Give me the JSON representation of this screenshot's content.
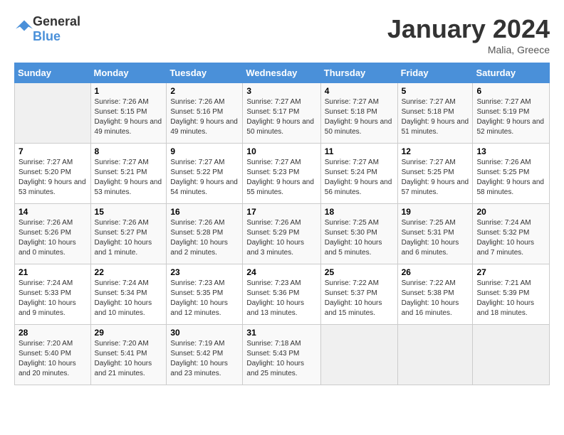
{
  "header": {
    "logo_general": "General",
    "logo_blue": "Blue",
    "title": "January 2024",
    "subtitle": "Malia, Greece"
  },
  "weekdays": [
    "Sunday",
    "Monday",
    "Tuesday",
    "Wednesday",
    "Thursday",
    "Friday",
    "Saturday"
  ],
  "weeks": [
    [
      {
        "day": "",
        "sunrise": "",
        "sunset": "",
        "daylight": ""
      },
      {
        "day": "1",
        "sunrise": "Sunrise: 7:26 AM",
        "sunset": "Sunset: 5:15 PM",
        "daylight": "Daylight: 9 hours and 49 minutes."
      },
      {
        "day": "2",
        "sunrise": "Sunrise: 7:26 AM",
        "sunset": "Sunset: 5:16 PM",
        "daylight": "Daylight: 9 hours and 49 minutes."
      },
      {
        "day": "3",
        "sunrise": "Sunrise: 7:27 AM",
        "sunset": "Sunset: 5:17 PM",
        "daylight": "Daylight: 9 hours and 50 minutes."
      },
      {
        "day": "4",
        "sunrise": "Sunrise: 7:27 AM",
        "sunset": "Sunset: 5:18 PM",
        "daylight": "Daylight: 9 hours and 50 minutes."
      },
      {
        "day": "5",
        "sunrise": "Sunrise: 7:27 AM",
        "sunset": "Sunset: 5:18 PM",
        "daylight": "Daylight: 9 hours and 51 minutes."
      },
      {
        "day": "6",
        "sunrise": "Sunrise: 7:27 AM",
        "sunset": "Sunset: 5:19 PM",
        "daylight": "Daylight: 9 hours and 52 minutes."
      }
    ],
    [
      {
        "day": "7",
        "sunrise": "Sunrise: 7:27 AM",
        "sunset": "Sunset: 5:20 PM",
        "daylight": "Daylight: 9 hours and 53 minutes."
      },
      {
        "day": "8",
        "sunrise": "Sunrise: 7:27 AM",
        "sunset": "Sunset: 5:21 PM",
        "daylight": "Daylight: 9 hours and 53 minutes."
      },
      {
        "day": "9",
        "sunrise": "Sunrise: 7:27 AM",
        "sunset": "Sunset: 5:22 PM",
        "daylight": "Daylight: 9 hours and 54 minutes."
      },
      {
        "day": "10",
        "sunrise": "Sunrise: 7:27 AM",
        "sunset": "Sunset: 5:23 PM",
        "daylight": "Daylight: 9 hours and 55 minutes."
      },
      {
        "day": "11",
        "sunrise": "Sunrise: 7:27 AM",
        "sunset": "Sunset: 5:24 PM",
        "daylight": "Daylight: 9 hours and 56 minutes."
      },
      {
        "day": "12",
        "sunrise": "Sunrise: 7:27 AM",
        "sunset": "Sunset: 5:25 PM",
        "daylight": "Daylight: 9 hours and 57 minutes."
      },
      {
        "day": "13",
        "sunrise": "Sunrise: 7:26 AM",
        "sunset": "Sunset: 5:25 PM",
        "daylight": "Daylight: 9 hours and 58 minutes."
      }
    ],
    [
      {
        "day": "14",
        "sunrise": "Sunrise: 7:26 AM",
        "sunset": "Sunset: 5:26 PM",
        "daylight": "Daylight: 10 hours and 0 minutes."
      },
      {
        "day": "15",
        "sunrise": "Sunrise: 7:26 AM",
        "sunset": "Sunset: 5:27 PM",
        "daylight": "Daylight: 10 hours and 1 minute."
      },
      {
        "day": "16",
        "sunrise": "Sunrise: 7:26 AM",
        "sunset": "Sunset: 5:28 PM",
        "daylight": "Daylight: 10 hours and 2 minutes."
      },
      {
        "day": "17",
        "sunrise": "Sunrise: 7:26 AM",
        "sunset": "Sunset: 5:29 PM",
        "daylight": "Daylight: 10 hours and 3 minutes."
      },
      {
        "day": "18",
        "sunrise": "Sunrise: 7:25 AM",
        "sunset": "Sunset: 5:30 PM",
        "daylight": "Daylight: 10 hours and 5 minutes."
      },
      {
        "day": "19",
        "sunrise": "Sunrise: 7:25 AM",
        "sunset": "Sunset: 5:31 PM",
        "daylight": "Daylight: 10 hours and 6 minutes."
      },
      {
        "day": "20",
        "sunrise": "Sunrise: 7:24 AM",
        "sunset": "Sunset: 5:32 PM",
        "daylight": "Daylight: 10 hours and 7 minutes."
      }
    ],
    [
      {
        "day": "21",
        "sunrise": "Sunrise: 7:24 AM",
        "sunset": "Sunset: 5:33 PM",
        "daylight": "Daylight: 10 hours and 9 minutes."
      },
      {
        "day": "22",
        "sunrise": "Sunrise: 7:24 AM",
        "sunset": "Sunset: 5:34 PM",
        "daylight": "Daylight: 10 hours and 10 minutes."
      },
      {
        "day": "23",
        "sunrise": "Sunrise: 7:23 AM",
        "sunset": "Sunset: 5:35 PM",
        "daylight": "Daylight: 10 hours and 12 minutes."
      },
      {
        "day": "24",
        "sunrise": "Sunrise: 7:23 AM",
        "sunset": "Sunset: 5:36 PM",
        "daylight": "Daylight: 10 hours and 13 minutes."
      },
      {
        "day": "25",
        "sunrise": "Sunrise: 7:22 AM",
        "sunset": "Sunset: 5:37 PM",
        "daylight": "Daylight: 10 hours and 15 minutes."
      },
      {
        "day": "26",
        "sunrise": "Sunrise: 7:22 AM",
        "sunset": "Sunset: 5:38 PM",
        "daylight": "Daylight: 10 hours and 16 minutes."
      },
      {
        "day": "27",
        "sunrise": "Sunrise: 7:21 AM",
        "sunset": "Sunset: 5:39 PM",
        "daylight": "Daylight: 10 hours and 18 minutes."
      }
    ],
    [
      {
        "day": "28",
        "sunrise": "Sunrise: 7:20 AM",
        "sunset": "Sunset: 5:40 PM",
        "daylight": "Daylight: 10 hours and 20 minutes."
      },
      {
        "day": "29",
        "sunrise": "Sunrise: 7:20 AM",
        "sunset": "Sunset: 5:41 PM",
        "daylight": "Daylight: 10 hours and 21 minutes."
      },
      {
        "day": "30",
        "sunrise": "Sunrise: 7:19 AM",
        "sunset": "Sunset: 5:42 PM",
        "daylight": "Daylight: 10 hours and 23 minutes."
      },
      {
        "day": "31",
        "sunrise": "Sunrise: 7:18 AM",
        "sunset": "Sunset: 5:43 PM",
        "daylight": "Daylight: 10 hours and 25 minutes."
      },
      {
        "day": "",
        "sunrise": "",
        "sunset": "",
        "daylight": ""
      },
      {
        "day": "",
        "sunrise": "",
        "sunset": "",
        "daylight": ""
      },
      {
        "day": "",
        "sunrise": "",
        "sunset": "",
        "daylight": ""
      }
    ]
  ]
}
